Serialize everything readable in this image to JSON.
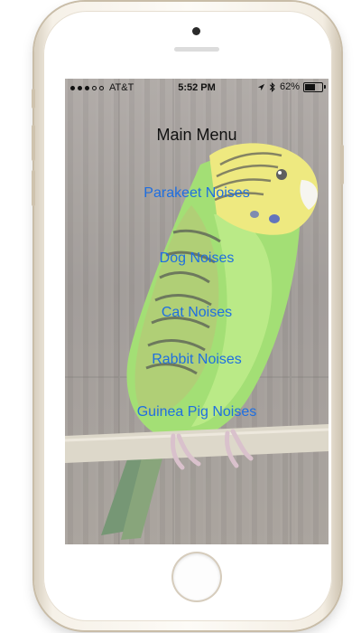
{
  "status_bar": {
    "carrier": "AT&T",
    "time": "5:52 PM",
    "battery_percent": "62%",
    "signal_bars_filled": 3,
    "signal_bars_total": 5,
    "battery_level": 0.62
  },
  "screen": {
    "title": "Main Menu",
    "menu_items": [
      "Parakeet Noises",
      "Dog Noises",
      "Cat Noises",
      "Rabbit Noises",
      "Guinea Pig Noises"
    ]
  },
  "colors": {
    "link": "#1f6fe0",
    "text": "#111111"
  },
  "icons": {
    "location": "location-arrow-icon",
    "bluetooth": "bluetooth-icon",
    "battery": "battery-icon"
  }
}
